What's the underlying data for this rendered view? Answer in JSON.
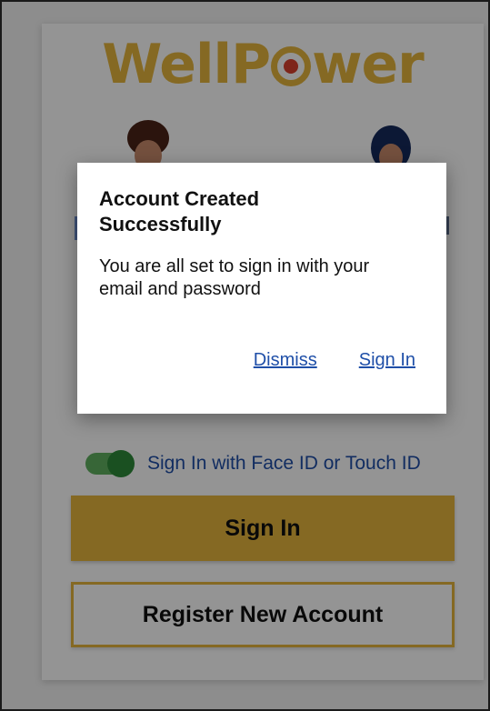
{
  "app": {
    "logo_text_before": "WellP",
    "logo_text_after": "wer"
  },
  "login": {
    "biometric_label": "Sign In with Face ID or Touch ID",
    "biometric_enabled": true,
    "sign_in_label": "Sign In",
    "register_label": "Register New Account"
  },
  "dialog": {
    "title": "Account Created Successfully",
    "message": "You are all set to sign in with your email and password",
    "dismiss_label": "Dismiss",
    "sign_in_label": "Sign In"
  },
  "colors": {
    "brand_gold": "#e6b63d",
    "brand_red": "#d9412e",
    "link_blue": "#1f4fa8",
    "toggle_green": "#2e8b3a"
  }
}
